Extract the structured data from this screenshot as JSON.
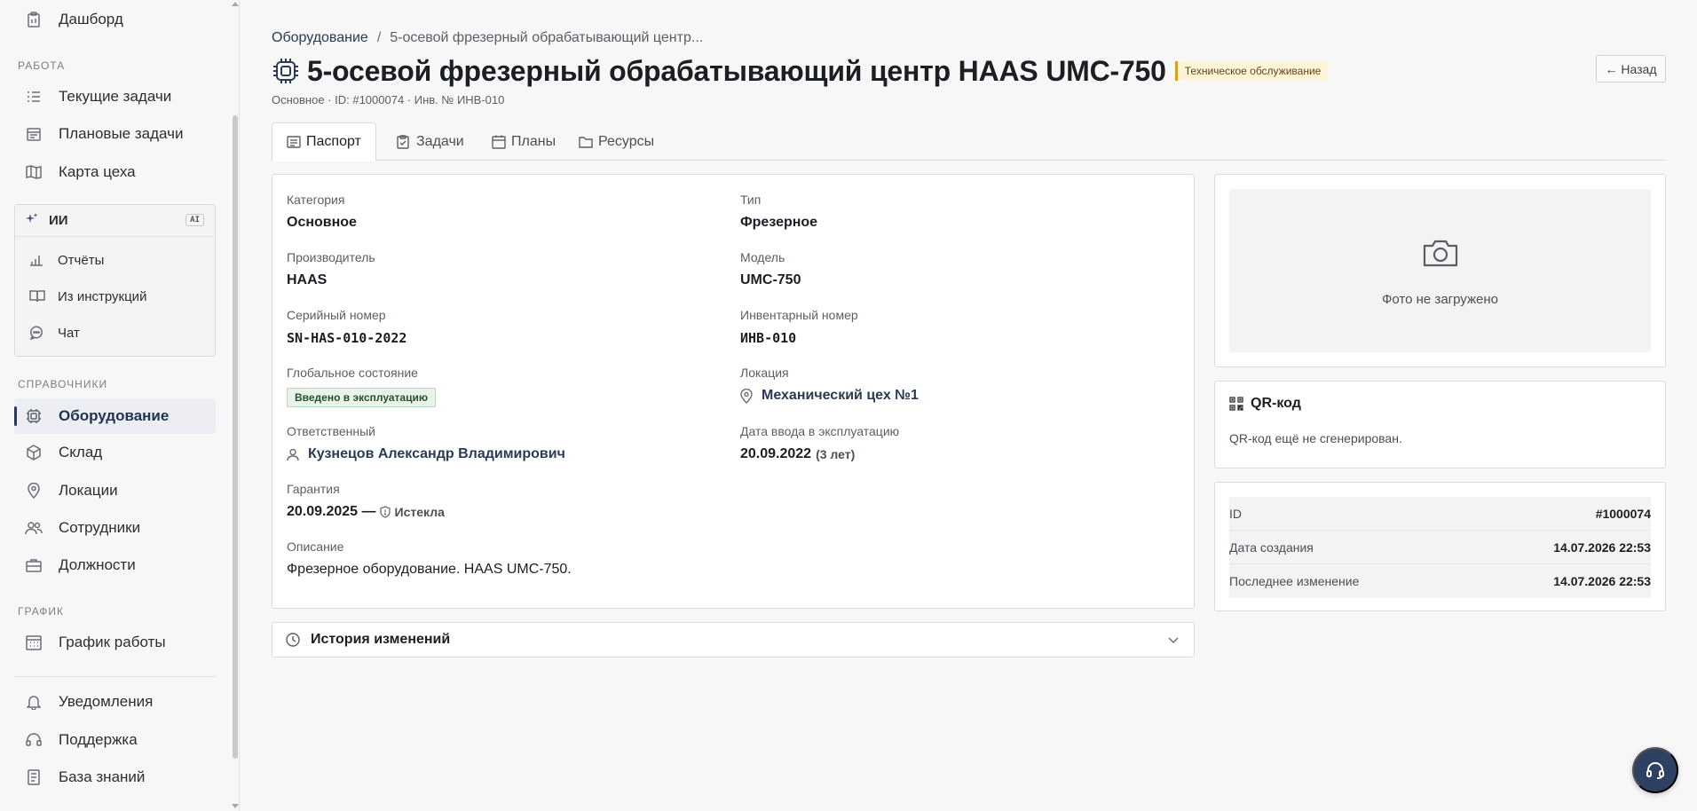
{
  "sidebar": {
    "top_item": "Дашборд",
    "section_work": "РАБОТА",
    "work_items": [
      "Текущие задачи",
      "Плановые задачи",
      "Карта цеха"
    ],
    "ai": {
      "title": "ИИ",
      "badge": "AI",
      "items": [
        "Отчёты",
        "Из инструкций",
        "Чат"
      ]
    },
    "section_refs": "СПРАВОЧНИКИ",
    "ref_items": [
      "Оборудование",
      "Склад",
      "Локации",
      "Сотрудники",
      "Должности"
    ],
    "section_schedule": "ГРАФИК",
    "schedule_items": [
      "График работы"
    ],
    "bottom_items": [
      "Уведомления",
      "Поддержка",
      "База знаний"
    ]
  },
  "header": {
    "breadcrumb_root": "Оборудование",
    "breadcrumb_sep": "/",
    "breadcrumb_current": "5-осевой фрезерный обрабатывающий центр...",
    "title": "5-осевой фрезерный обрабатывающий центр HAAS UMC-750",
    "status": "Техническое обслуживание",
    "subtitle": "Основное · ID: #1000074 · Инв. № ИНВ-010",
    "back_label": "← Назад"
  },
  "tabs": [
    "Паспорт",
    "Задачи",
    "Планы",
    "Ресурсы"
  ],
  "passport": {
    "category_label": "Категория",
    "category_value": "Основное",
    "type_label": "Тип",
    "type_value": "Фрезерное",
    "manufacturer_label": "Производитель",
    "manufacturer_value": "HAAS",
    "model_label": "Модель",
    "model_value": "UMC-750",
    "serial_label": "Серийный номер",
    "serial_value": "SN-HAS-010-2022",
    "inventory_label": "Инвентарный номер",
    "inventory_value": "ИНВ-010",
    "global_state_label": "Глобальное состояние",
    "global_state_value": "Введено в эксплуатацию",
    "location_label": "Локация",
    "location_value": "Механический цех №1",
    "responsible_label": "Ответственный",
    "responsible_value": "Кузнецов Александр Владимирович",
    "commission_label": "Дата ввода в эксплуатацию",
    "commission_value": "20.09.2022",
    "commission_age": "(3 лет)",
    "warranty_label": "Гарантия",
    "warranty_value": "20.09.2025 —",
    "warranty_status": "Истекла",
    "description_label": "Описание",
    "description_value": "Фрезерное оборудование. HAAS UMC-750."
  },
  "history": {
    "title": "История изменений"
  },
  "photo": {
    "empty_text": "Фото не загружено"
  },
  "qr": {
    "title": "QR-код",
    "empty_text": "QR-код ещё не сгенерирован."
  },
  "meta": [
    {
      "key": "ID",
      "value": "#1000074"
    },
    {
      "key": "Дата создания",
      "value": "14.07.2026 22:53"
    },
    {
      "key": "Последнее изменение",
      "value": "14.07.2026 22:53"
    }
  ],
  "colors": {
    "accent": "#2b3a55",
    "status_warning": "#d1a21c",
    "status_ok": "#25522a",
    "support_button": "#2e4162"
  }
}
